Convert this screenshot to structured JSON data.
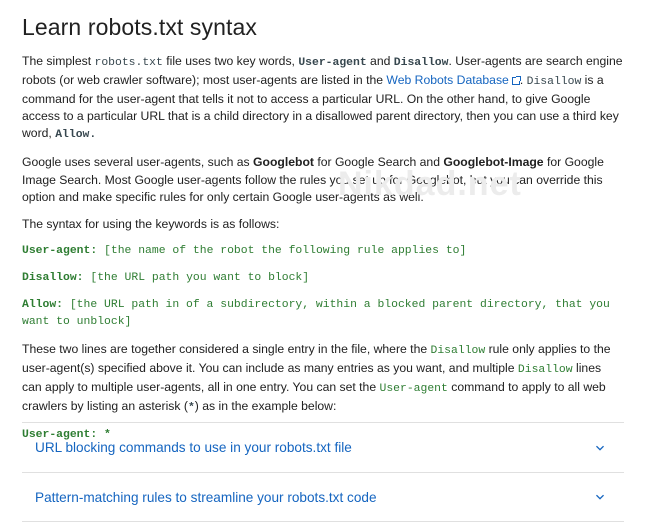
{
  "title": "Learn robots.txt syntax",
  "p1": {
    "t1": "The simplest ",
    "c1": "robots.txt",
    "t2": " file uses two key words, ",
    "c2": "User-agent",
    "t3": " and ",
    "c3": "Disallow",
    "t4": ". User-agents are search engine robots (or web crawler software); most user-agents are listed in the ",
    "link": "Web Robots Database",
    "t5": ". ",
    "c4": "Disallow",
    "t6": " is a command for the user-agent that tells it not to access a particular URL. On the other hand, to give Google access to a particular URL that is a child directory in a disallowed parent directory, then you can use a third key word, ",
    "c5": "Allow.",
    "t7": ""
  },
  "p2": {
    "t1": "Google uses several user-agents, such as ",
    "b1": "Googlebot",
    "t2": " for Google Search and ",
    "b2": "Googlebot-Image",
    "t3": " for Google Image Search. Most Google user-agents follow the rules you set up for Googlebot, but you can override this option and make specific rules for only certain Google user-agents as well."
  },
  "p3": "The syntax for using the keywords is as follows:",
  "syntax": [
    {
      "key": "User-agent:",
      "value": " [the name of the robot the following rule applies to]"
    },
    {
      "key": "Disallow:",
      "value": " [the URL path you want to block]"
    },
    {
      "key": "Allow:",
      "value": " [the URL path in of a subdirectory, within a blocked parent directory, that you want to unblock]"
    }
  ],
  "p4": {
    "t1": "These two lines are together considered a single entry in the file, where the ",
    "c1": "Disallow",
    "t2": " rule only applies to the user-agent(s) specified above it. You can include as many entries as you want, and multiple ",
    "c2": "Disallow",
    "t3": " lines can apply to multiple user-agents, all in one entry. You can set the ",
    "c3": "User-agent",
    "t4": "  command to apply to all web crawlers by listing an asterisk (",
    "c4": "*",
    "t5": ") as in the example below:"
  },
  "example": {
    "key": "User-agent:",
    "value": " *"
  },
  "watermark": "Nikdad.net",
  "accordion": [
    {
      "label": "URL blocking commands to use in your robots.txt file"
    },
    {
      "label": "Pattern-matching rules to streamline your robots.txt code"
    }
  ],
  "colors": {
    "link": "#1565c0",
    "code_green": "#2e7d32",
    "text": "#212121"
  },
  "icons": {
    "external": "external-link-icon",
    "expand": "chevron-down-icon"
  }
}
